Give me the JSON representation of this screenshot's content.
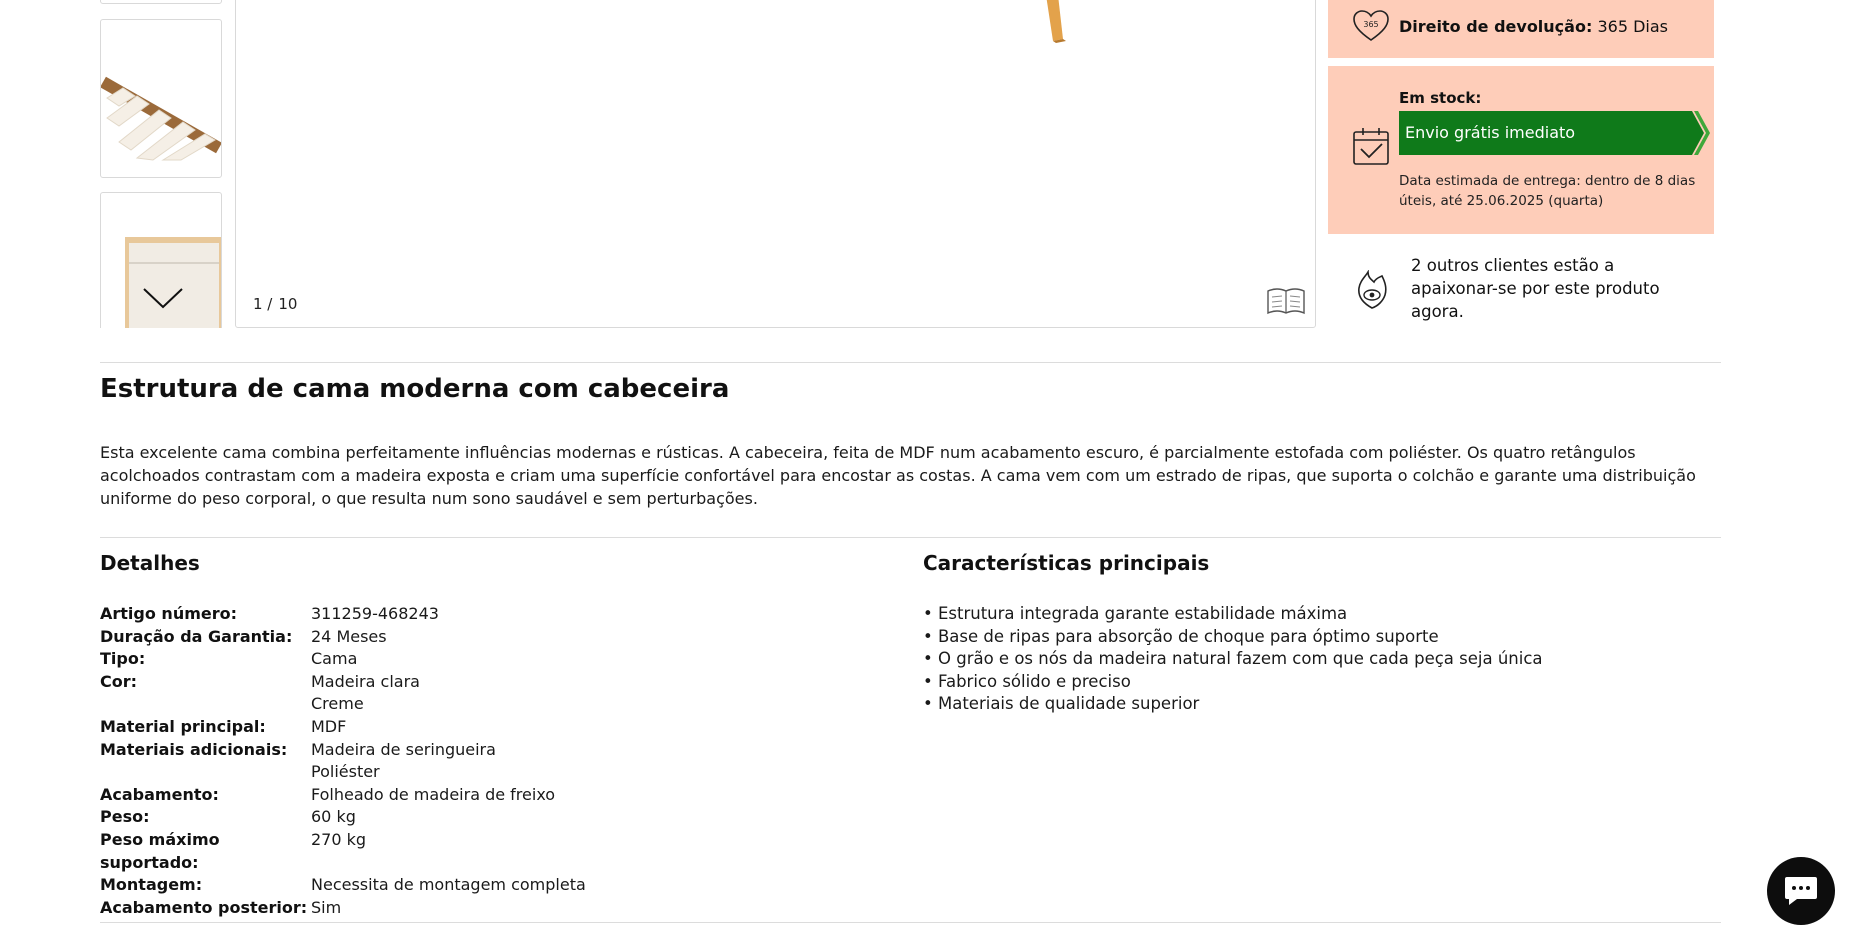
{
  "gallery": {
    "counter_current": "1 /",
    "counter_total": "10"
  },
  "returns": {
    "badge": "365",
    "label": "Direito de devolução:",
    "value": "365 Dias"
  },
  "stock": {
    "label": "Em stock:",
    "banner": "Envio grátis imediato",
    "delivery": "Data estimada de entrega: dentro de 8 dias úteis, até 25.06.2025 (quarta)"
  },
  "social_proof": {
    "text": "2 outros clientes estão a apaixonar-se por este produto agora."
  },
  "product": {
    "title": "Estrutura de cama moderna com cabeceira",
    "description": "Esta excelente cama combina perfeitamente influências modernas e rústicas. A cabeceira, feita de MDF num acabamento escuro, é parcialmente estofada com poliéster. Os quatro retângulos acolchoados contrastam com a madeira exposta e criam uma superfície confortável para encostar as costas. A cama vem com um estrado de ripas, que suporta o colchão e garante uma distribuição uniforme do peso corporal, o que resulta num sono saudável e sem perturbações."
  },
  "details": {
    "heading": "Detalhes",
    "rows": [
      {
        "key": "Artigo número:",
        "values": [
          "311259-468243"
        ]
      },
      {
        "key": "Duração da Garantia:",
        "values": [
          "24 Meses"
        ]
      },
      {
        "key": "Tipo:",
        "values": [
          "Cama"
        ]
      },
      {
        "key": "Cor:",
        "values": [
          "Madeira clara",
          "Creme"
        ]
      },
      {
        "key": "Material principal:",
        "values": [
          "MDF"
        ]
      },
      {
        "key": "Materiais adicionais:",
        "values": [
          "Madeira de seringueira",
          "Poliéster"
        ]
      },
      {
        "key": "Acabamento:",
        "values": [
          "Folheado de madeira de freixo"
        ]
      },
      {
        "key": "Peso:",
        "values": [
          "60 kg"
        ]
      },
      {
        "key": "Peso máximo suportado:",
        "values": [
          "270 kg"
        ]
      },
      {
        "key": "Montagem:",
        "values": [
          "Necessita de montagem completa"
        ]
      },
      {
        "key": "Acabamento posterior:",
        "values": [
          "Sim"
        ]
      }
    ]
  },
  "features": {
    "heading": "Características principais",
    "items": [
      "Estrutura integrada garante estabilidade máxima",
      "Base de ripas para absorção de choque para óptimo suporte",
      "O grão e os nós da madeira natural fazem com que cada peça seja única",
      "Fabrico sólido e preciso",
      "Materiais de qualidade superior"
    ]
  },
  "colors": {
    "highlight_bg": "#fecdb9",
    "stock_green": "#0f7a1a",
    "chat_bg": "#0d0d0d"
  }
}
